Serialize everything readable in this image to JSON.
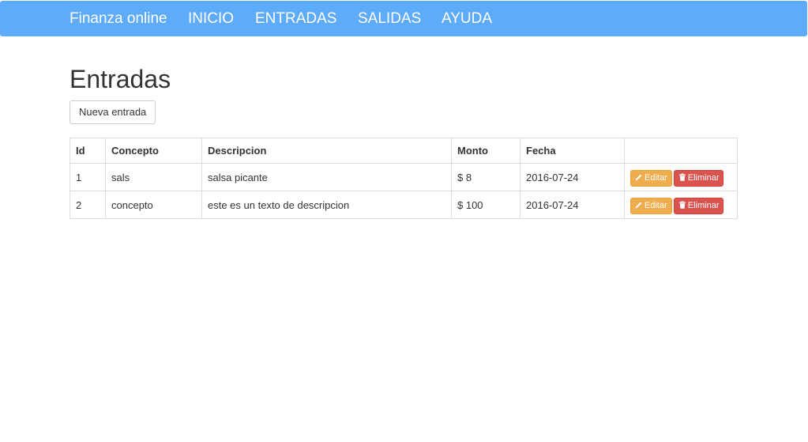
{
  "navbar": {
    "brand": "Finanza online",
    "links": [
      "INICIO",
      "ENTRADAS",
      "SALIDAS",
      "AYUDA"
    ]
  },
  "page": {
    "title": "Entradas",
    "new_button": "Nueva entrada"
  },
  "table": {
    "headers": [
      "Id",
      "Concepto",
      "Descripcion",
      "Monto",
      "Fecha",
      ""
    ],
    "rows": [
      {
        "id": "1",
        "concepto": "sals",
        "descripcion": "salsa picante",
        "monto": "$ 8",
        "fecha": "2016-07-24"
      },
      {
        "id": "2",
        "concepto": "concepto",
        "descripcion": "este es un texto de descripcion",
        "monto": "$ 100",
        "fecha": "2016-07-24"
      }
    ],
    "edit_label": "Editar",
    "delete_label": "Eliminar"
  },
  "colors": {
    "navbar": "#5dabf9",
    "warning": "#f0ad4e",
    "danger": "#d9534f"
  },
  "icons": {
    "edit": "pencil-icon",
    "delete": "trash-icon"
  }
}
